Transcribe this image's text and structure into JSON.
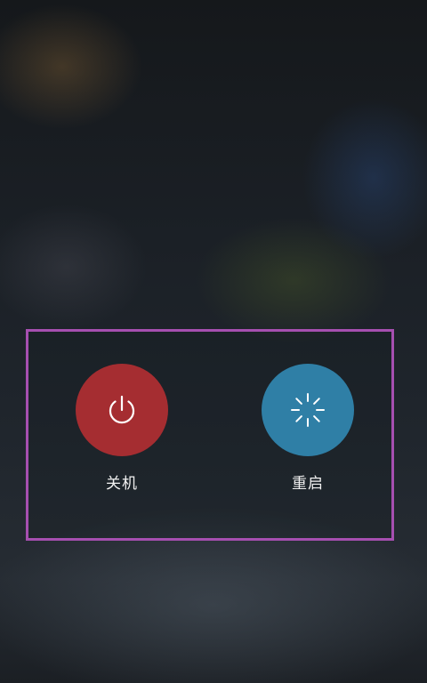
{
  "power_menu": {
    "options": [
      {
        "label": "关机",
        "icon": "power-icon",
        "color": "#a52d31"
      },
      {
        "label": "重启",
        "icon": "restart-icon",
        "color": "#2f7fa6"
      }
    ],
    "highlight_color": "#a64fb0"
  }
}
